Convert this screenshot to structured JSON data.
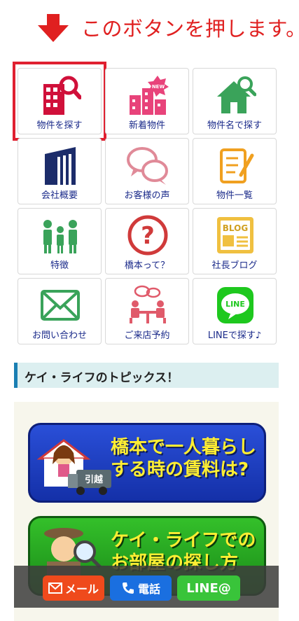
{
  "instruction": {
    "text": "このボタンを押します。"
  },
  "tiles": [
    {
      "label": "物件を探す"
    },
    {
      "label": "新着物件",
      "badge": "NEW"
    },
    {
      "label": "物件名で探す"
    },
    {
      "label": "会社概要"
    },
    {
      "label": "お客様の声"
    },
    {
      "label": "物件一覧"
    },
    {
      "label": "特徴"
    },
    {
      "label": "橋本って？",
      "glyph": "?"
    },
    {
      "label": "社長ブログ",
      "glyph": "BLOG"
    },
    {
      "label": "お問い合わせ"
    },
    {
      "label": "ご来店予約"
    },
    {
      "label": "LINEで探す♪",
      "glyph": "LINE"
    }
  ],
  "topics": {
    "title": "ケイ・ライフのトピックス！"
  },
  "banners": [
    {
      "line1": "橋本で一人暮らし",
      "line2": "する時の賃料は?",
      "truck_text": "引越"
    },
    {
      "line1": "ケイ・ライフでの",
      "line2": "お部屋の探し方"
    }
  ],
  "bottom_bar": {
    "mail": "メール",
    "tel": "電話",
    "line": "LINE@"
  },
  "colors": {
    "accent_red": "#e02030",
    "tile_label": "#1a2a8a",
    "navy": "#1c2c6a",
    "green": "#3aa35a",
    "pink": "#e8437a",
    "orange": "#f0a020"
  }
}
